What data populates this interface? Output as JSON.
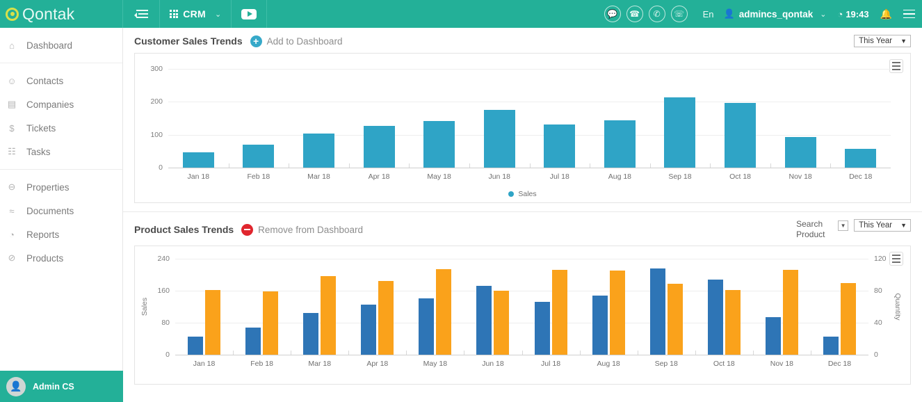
{
  "topbar": {
    "brand": "Qontak",
    "collapse_icon": "collapse-menu-icon",
    "app_switcher_label": "CRM",
    "app_switcher_caret": "⌄",
    "youtube_icon": "youtube-icon",
    "icons": [
      {
        "name": "chat-icon",
        "glyph": "⌨"
      },
      {
        "name": "phone-icon",
        "glyph": "✆"
      },
      {
        "name": "call-log-icon",
        "glyph": "✇"
      },
      {
        "name": "incoming-call-icon",
        "glyph": "↙"
      }
    ],
    "language": "En",
    "user_icon": "●",
    "username": "admincs_qontak",
    "user_caret": "⌄",
    "clock_icon": "◔",
    "time": "19:43",
    "bell_icon": "␆"
  },
  "sidebar": {
    "groups": [
      {
        "items": [
          {
            "label": "Dashboard",
            "icon": "⌂",
            "icon_name": "home-icon"
          }
        ]
      },
      {
        "items": [
          {
            "label": "Contacts",
            "icon": "☺",
            "icon_name": "contacts-icon"
          },
          {
            "label": "Companies",
            "icon": "▤",
            "icon_name": "companies-icon"
          },
          {
            "label": "Tickets",
            "icon": "$",
            "icon_name": "tickets-icon"
          },
          {
            "label": "Tasks",
            "icon": "☷",
            "icon_name": "tasks-icon"
          }
        ]
      },
      {
        "items": [
          {
            "label": "Properties",
            "icon": "⊖",
            "icon_name": "properties-icon"
          },
          {
            "label": "Documents",
            "icon": "≈",
            "icon_name": "documents-icon"
          },
          {
            "label": "Reports",
            "icon": "◔",
            "icon_name": "reports-icon"
          },
          {
            "label": "Products",
            "icon": "⊘",
            "icon_name": "products-icon"
          }
        ]
      }
    ],
    "footer_user": "Admin CS",
    "footer_avatar_glyph": "☺"
  },
  "cards": [
    {
      "title": "Customer Sales Trends",
      "action_label": "Add to Dashboard",
      "action_icon": "plus-circle-icon",
      "period": "This Year",
      "period_caret": "▼"
    },
    {
      "title": "Product Sales Trends",
      "action_label": "Remove from Dashboard",
      "action_icon": "minus-circle-icon",
      "search_label_line1": "Search",
      "search_label_line2": "Product",
      "search_caret": "▼",
      "period": "This Year",
      "period_caret": "▼"
    }
  ],
  "colors": {
    "brand_teal": "#23b098",
    "sales_blue": "#2fa4c6",
    "product_blue": "#2e75b6",
    "product_orange": "#faa21b",
    "add_icon": "#36a9c9",
    "remove_icon": "#e0262e"
  },
  "chart_data": [
    {
      "type": "bar",
      "title": "Customer Sales Trends",
      "categories": [
        "Jan 18",
        "Feb 18",
        "Mar 18",
        "Apr 18",
        "May 18",
        "Jun 18",
        "Jul 18",
        "Aug 18",
        "Sep 18",
        "Oct 18",
        "Nov 18",
        "Dec 18"
      ],
      "series": [
        {
          "name": "Sales",
          "color": "#2fa4c6",
          "values": [
            47,
            70,
            104,
            126,
            141,
            175,
            131,
            144,
            214,
            197,
            92,
            57
          ]
        }
      ],
      "xlabel": "",
      "ylabel": "",
      "ylim": [
        0,
        300
      ],
      "yticks": [
        0,
        100,
        200,
        300
      ],
      "grid": true,
      "legend": [
        "Sales"
      ],
      "legend_position": "bottom"
    },
    {
      "type": "bar",
      "title": "Product Sales Trends",
      "categories": [
        "Jan 18",
        "Feb 18",
        "Mar 18",
        "Apr 18",
        "May 18",
        "Jun 18",
        "Jul 18",
        "Aug 18",
        "Sep 18",
        "Oct 18",
        "Nov 18",
        "Dec 18"
      ],
      "series": [
        {
          "name": "Sales",
          "color": "#2e75b6",
          "axis": "left",
          "values": [
            45,
            68,
            104,
            126,
            141,
            172,
            133,
            148,
            216,
            188,
            94,
            45
          ]
        },
        {
          "name": "Quantity",
          "color": "#faa21b",
          "axis": "right",
          "values": [
            81,
            79,
            98,
            92,
            107,
            80,
            106,
            105,
            89,
            81,
            106,
            90
          ]
        }
      ],
      "xlabel": "",
      "ylabel": "Sales",
      "y2label": "Quantity",
      "ylim": [
        0,
        240
      ],
      "yticks": [
        0,
        80,
        160,
        240
      ],
      "y2lim": [
        0,
        120
      ],
      "y2ticks": [
        0,
        40,
        80,
        120
      ],
      "grid": true,
      "legend": [],
      "legend_position": "none"
    }
  ]
}
